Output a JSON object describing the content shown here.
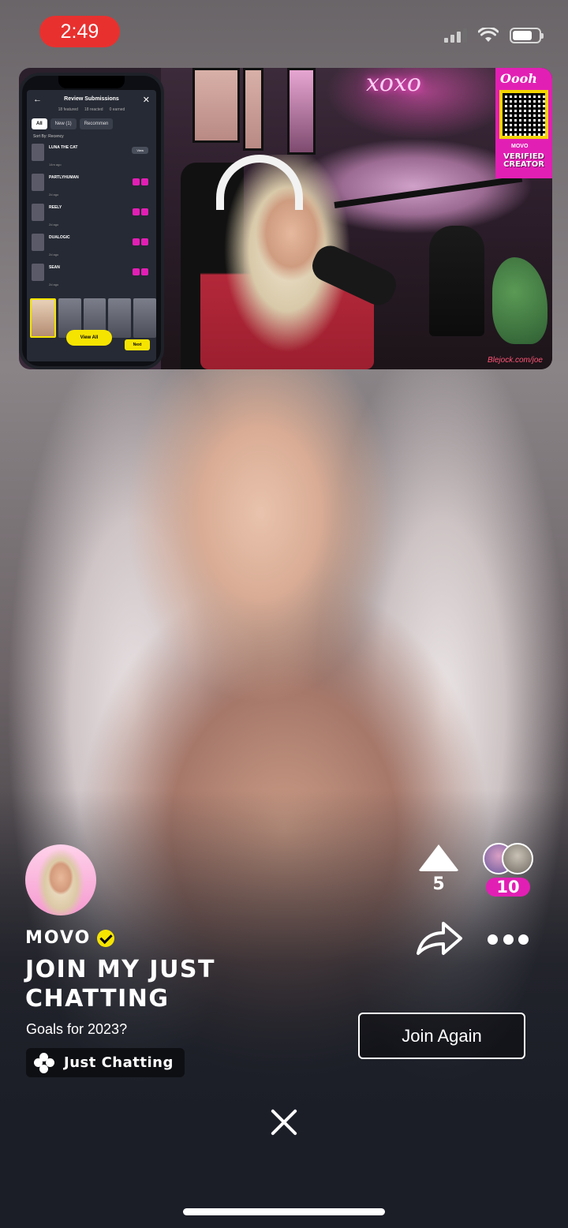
{
  "status_bar": {
    "time": "2:49",
    "cellular_icon": "cellular-signal-icon",
    "wifi_icon": "wifi-icon",
    "battery_icon": "battery-icon",
    "battery_level": 0.75
  },
  "stream_overlay": {
    "neon_sign": "xoxo",
    "qr_logo": "Oooh",
    "qr_brand": "MOVO",
    "qr_badge": "VERIFIED CREATOR",
    "credit": "Blejock.com/joe",
    "phone": {
      "title": "Review Submissions",
      "stats": [
        "18 featured",
        "18 reacted",
        "0 earned"
      ],
      "tabs": [
        "All",
        "New (1)",
        "Recommen"
      ],
      "sort_label": "Sort By: Recency",
      "rows": [
        {
          "name": "LUNA THE CAT",
          "ago": "14m ago",
          "action": "View"
        },
        {
          "name": "PARTLYHUMAN",
          "ago": "2d ago"
        },
        {
          "name": "REELY",
          "ago": "2d ago"
        },
        {
          "name": "DUALOGIC",
          "ago": "2d ago"
        },
        {
          "name": "SEAN",
          "ago": "2d ago"
        }
      ],
      "view_all": "View All",
      "next": "Next"
    }
  },
  "actions": {
    "upvote_icon": "upvote-arrow-icon",
    "upvote_count": "5",
    "viewer_count": "10",
    "share_icon": "share-arrow-icon",
    "more_icon": "more-dots-icon"
  },
  "creator": {
    "name": "MOVO",
    "verified_icon": "verified-check-icon",
    "title": "JOIN MY JUST CHATTING",
    "subtitle": "Goals for 2023?",
    "category_icon": "category-dots-icon",
    "category": "Just Chatting"
  },
  "join_button": "Join Again",
  "close_icon": "close-x-icon",
  "colors": {
    "accent_magenta": "#e21fb4",
    "accent_yellow": "#f5e400",
    "recording_red": "#e8312f",
    "background": "#1a1d26"
  }
}
